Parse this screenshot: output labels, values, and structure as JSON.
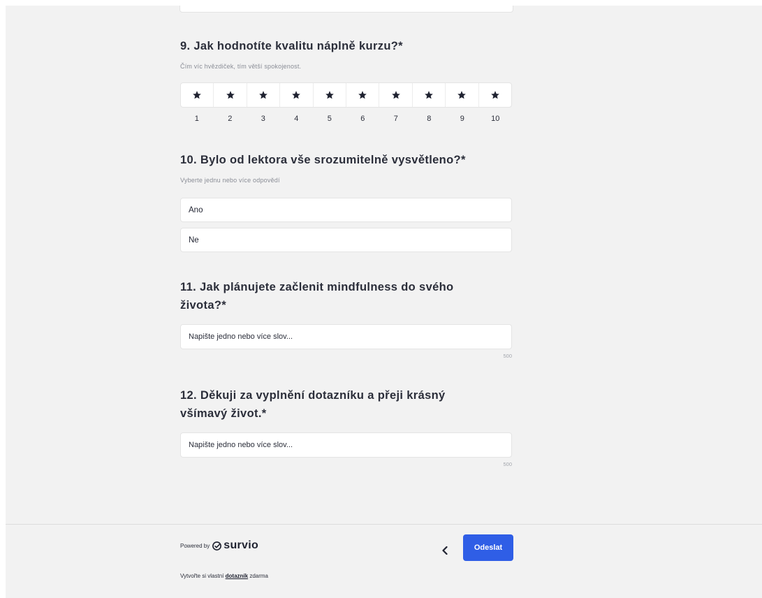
{
  "questions": {
    "q9": {
      "title": "9. Jak hodnotíte kvalitu náplně kurzu?*",
      "hint": "Čím víc hvězdiček, tím větší spokojenost.",
      "scale": [
        "1",
        "2",
        "3",
        "4",
        "5",
        "6",
        "7",
        "8",
        "9",
        "10"
      ],
      "star_icon": "star-icon"
    },
    "q10": {
      "title": "10. Bylo od lektora vše srozumitelně vysvětleno?*",
      "hint": "Vyberte jednu nebo více odpovědí",
      "options": [
        "Ano",
        "Ne"
      ]
    },
    "q11": {
      "title_line1": "11. Jak plánujete začlenit mindfulness do svého",
      "title_line2": "života?*",
      "placeholder": "Napište jedno nebo více slov...",
      "char_limit": "500"
    },
    "q12": {
      "title_line1": "12. Děkuji za vyplnění dotazníku a přeji krásný",
      "title_line2": "všímavý život.*",
      "placeholder": "Napište jedno nebo více slov...",
      "char_limit": "500"
    }
  },
  "footer": {
    "powered_by": "Powered by",
    "logo_text": "survio",
    "back_icon": "chevron-left-icon",
    "submit_label": "Odeslat",
    "create_prefix": "Vytvořte si vlastní",
    "create_link": "dotazník",
    "create_suffix": "zdarma"
  },
  "colors": {
    "page_background": "#f2f2f2",
    "accent": "#2f5ee6",
    "text": "#2b2e3a",
    "hint": "#8a8d96",
    "border": "#e4e4e4"
  }
}
